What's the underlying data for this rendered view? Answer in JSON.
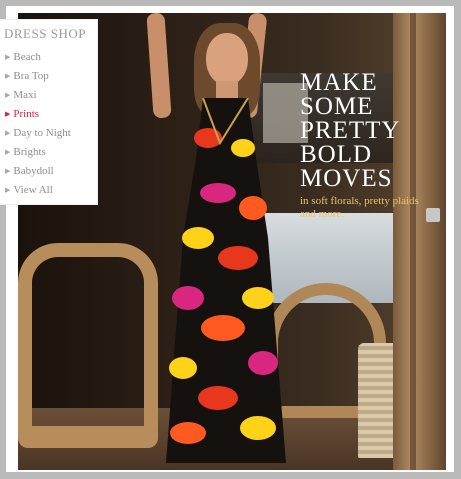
{
  "sidebar": {
    "title": "DRESS SHOP",
    "items": [
      {
        "label": "Beach",
        "active": false
      },
      {
        "label": "Bra Top",
        "active": false
      },
      {
        "label": "Maxi",
        "active": false
      },
      {
        "label": "Prints",
        "active": true
      },
      {
        "label": "Day to Night",
        "active": false
      },
      {
        "label": "Brights",
        "active": false
      },
      {
        "label": "Babydoll",
        "active": false
      },
      {
        "label": "View All",
        "active": false
      }
    ]
  },
  "promo": {
    "headline_lines": [
      "MAKE",
      "SOME",
      "PRETTY",
      "BOLD",
      "MOVES"
    ],
    "subtext": "in soft florals, pretty plaids and more."
  },
  "colors": {
    "active_nav": "#e0203a",
    "nav_text": "#8d8d8d",
    "promo_sub": "#e9c36a"
  }
}
